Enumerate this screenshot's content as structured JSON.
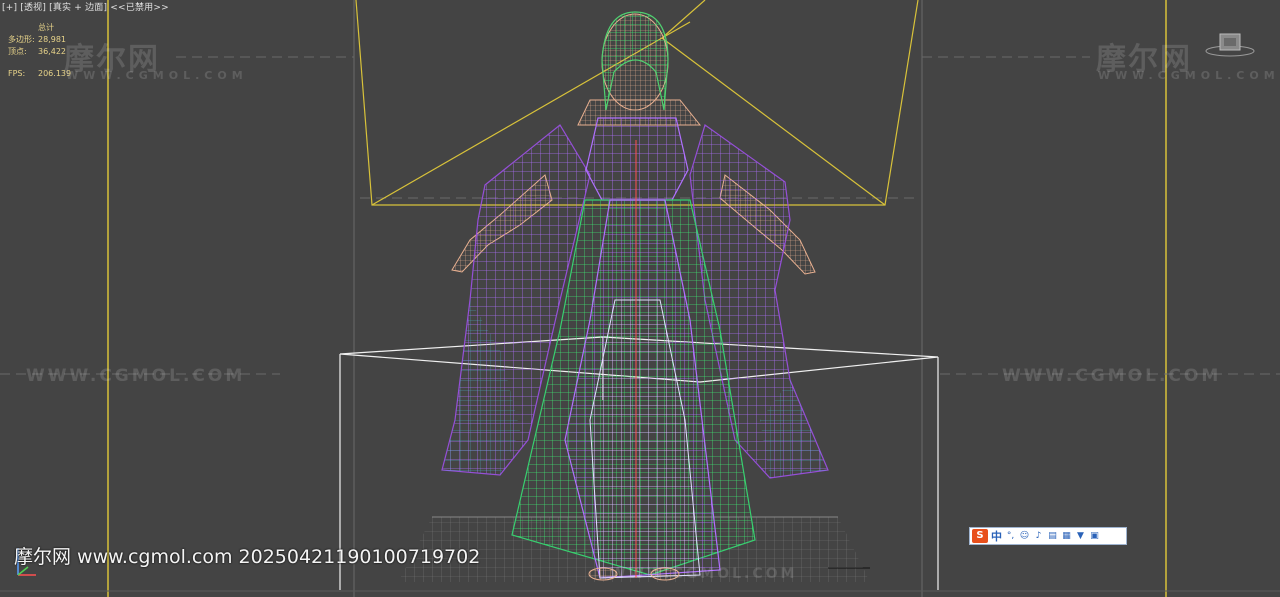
{
  "viewport": {
    "menu": {
      "plus": "[+]",
      "view": "[透视]",
      "shading": "[真实 + 边面]",
      "disabled": "<<已禁用>>"
    },
    "stats": {
      "header": "总计",
      "polygons_label": "多边形:",
      "polygons_value": "28,981",
      "vertices_label": "顶点:",
      "vertices_value": "36,422",
      "fps_label": "FPS:",
      "fps_value": "206.139"
    },
    "watermarks": {
      "logo": "摩尔网",
      "logo_sub": "WWW.CGMOL.COM",
      "url": "WWW.CGMOL.COM"
    },
    "stamp": "摩尔网 www.cgmol.com 20250421190100719702",
    "ime_toolbar": {
      "logo": "S",
      "mode": "中",
      "icons": [
        "punctuation-icon",
        "emoji-icon",
        "microphone-icon",
        "keyboard-icon",
        "toolbox-icon",
        "skin-icon",
        "menu-grid-icon"
      ]
    },
    "colors": {
      "background": "#444444",
      "frame_yellow": "#d8c23a",
      "stats_yellow": "#e8d48a",
      "wire_purple": "#9a50e0",
      "wire_green": "#38d070",
      "wire_cyan": "#40b8d8",
      "wire_skin": "#e8b090"
    }
  }
}
